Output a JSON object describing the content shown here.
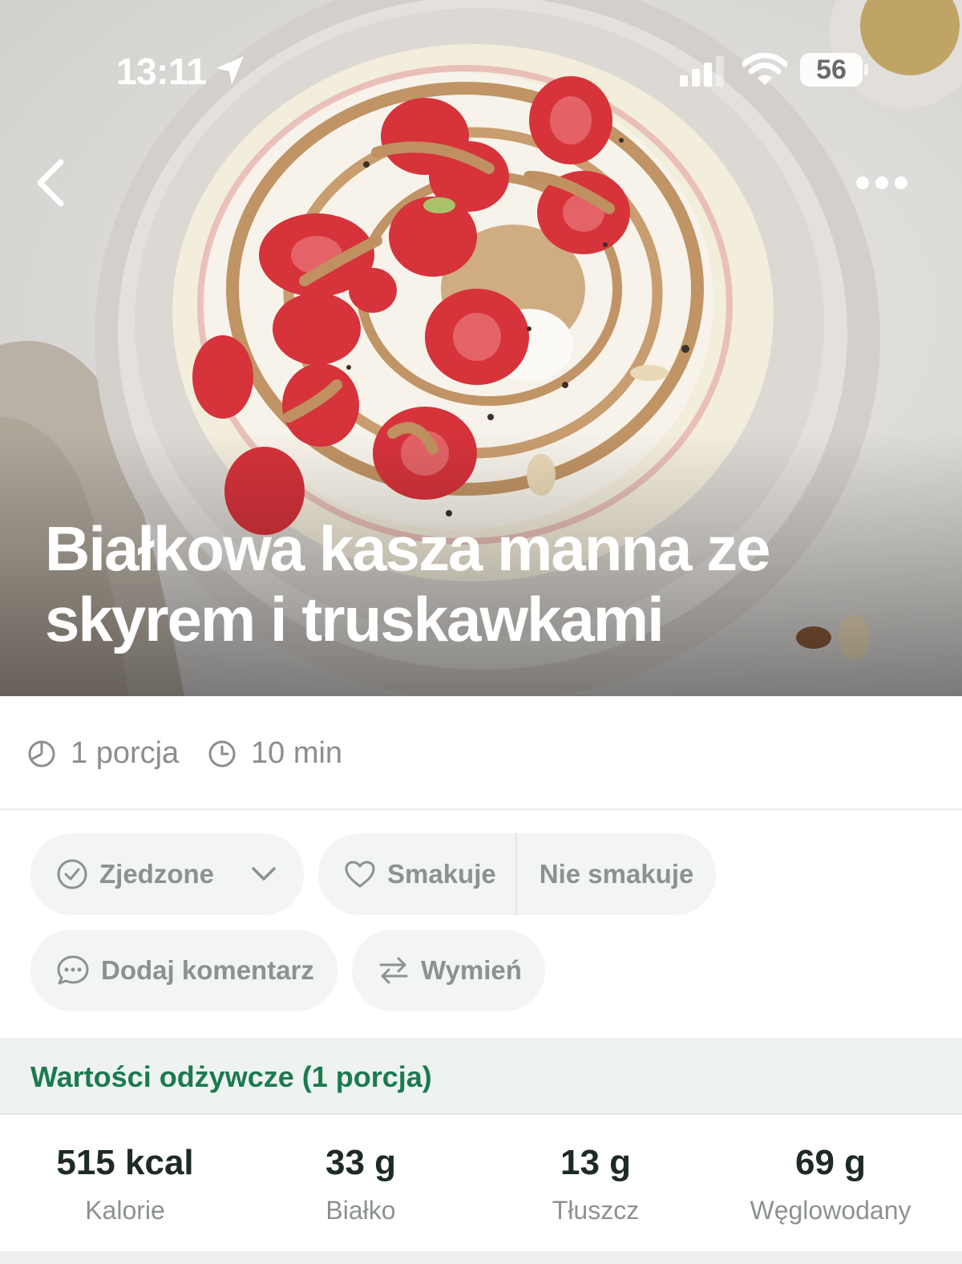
{
  "status_bar": {
    "time": "13:11",
    "battery": "56"
  },
  "recipe": {
    "title": "Białkowa kasza manna ze skyrem i truskawkami"
  },
  "meta": {
    "portions": "1 porcja",
    "time": "10 min"
  },
  "actions": {
    "eaten": "Zjedzone",
    "like": "Smakuje",
    "dislike": "Nie smakuje",
    "comment": "Dodaj komentarz",
    "swap": "Wymień"
  },
  "nutrition": {
    "header": "Wartości odżywcze (1 porcja)",
    "items": [
      {
        "value": "515 kcal",
        "label": "Kalorie"
      },
      {
        "value": "33 g",
        "label": "Białko"
      },
      {
        "value": "13 g",
        "label": "Tłuszcz"
      },
      {
        "value": "69 g",
        "label": "Węglowodany"
      }
    ]
  },
  "colors": {
    "accent": "#1c7a4e",
    "pill_bg": "#f3f4f4",
    "muted_text": "#8c9290",
    "section_bg": "#eef3f1"
  },
  "icons": [
    "location-arrow-icon",
    "signal-icon",
    "wifi-icon",
    "chevron-left-icon",
    "more-dots-icon",
    "pie-icon",
    "clock-icon",
    "check-circle-icon",
    "chevron-down-icon",
    "heart-icon",
    "comment-icon",
    "swap-arrows-icon"
  ]
}
